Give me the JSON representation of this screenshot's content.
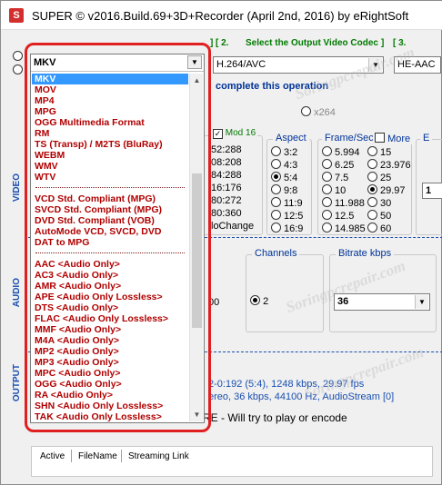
{
  "window": {
    "title": "SUPER © v2016.Build.69+3D+Recorder (April 2nd, 2016) by eRightSoft"
  },
  "steps": {
    "step1_tail": "]",
    "step2_num": "[ 2.",
    "step2_text": "Select the Output Video Codec",
    "step2_close": "]",
    "step3_num": "[ 3."
  },
  "controls": {
    "container_value": "MKV",
    "video_codec_value": "H.264/AVC",
    "audio_codec_value": "HE-AAC",
    "complete_text": "complete this operation",
    "encoder_radio": "x264",
    "mod16_label": "Mod 16",
    "aspect_title": "Aspect",
    "framerate_title": "Frame/Sec",
    "more_label": "More",
    "channels_title": "Channels",
    "channels_value": "2",
    "bitrate_title": "Bitrate  kbps",
    "bitrate_value": "36",
    "sampling_fragment": "00",
    "size_value": "1",
    "e_title": "E"
  },
  "size_options": [
    "52:288",
    "08:208",
    "84:288",
    "16:176",
    "80:272",
    "80:360",
    "loChange"
  ],
  "aspect_options": [
    {
      "label": "3:2",
      "on": false
    },
    {
      "label": "4:3",
      "on": false
    },
    {
      "label": "5:4",
      "on": true
    },
    {
      "label": "9:8",
      "on": false
    },
    {
      "label": "11:9",
      "on": false
    },
    {
      "label": "12:5",
      "on": false
    },
    {
      "label": "16:9",
      "on": false
    }
  ],
  "fps_col1": [
    {
      "label": "5.994",
      "on": false
    },
    {
      "label": "6.25",
      "on": false
    },
    {
      "label": "7.5",
      "on": false
    },
    {
      "label": "10",
      "on": false
    },
    {
      "label": "11.988",
      "on": false
    },
    {
      "label": "12.5",
      "on": false
    },
    {
      "label": "14.985",
      "on": false
    }
  ],
  "fps_col2": [
    {
      "label": "15",
      "on": false
    },
    {
      "label": "23.976",
      "on": false
    },
    {
      "label": "25",
      "on": false
    },
    {
      "label": "29.97",
      "on": true
    },
    {
      "label": "30",
      "on": false
    },
    {
      "label": "50",
      "on": false
    },
    {
      "label": "60",
      "on": false
    }
  ],
  "vertical_labels": {
    "video": "VIDEO",
    "audio": "AUDIO",
    "output": "OUTPUT"
  },
  "info": {
    "video_line": "2-0:192 (5:4),   1248 kbps,  29.97 fps",
    "audio_line": "ereo,  36 kbps,  44100 Hz,  AudioStream [0]",
    "play_line": "RE - Will try to play or encode"
  },
  "dropdown": {
    "selected": "MKV",
    "items": [
      {
        "label": "MKV",
        "sep": false,
        "selected": true
      },
      {
        "label": "MOV",
        "sep": false,
        "selected": false
      },
      {
        "label": "MP4",
        "sep": false,
        "selected": false
      },
      {
        "label": "MPG",
        "sep": false,
        "selected": false
      },
      {
        "label": "OGG  Multimedia Format",
        "sep": false,
        "selected": false
      },
      {
        "label": "RM",
        "sep": false,
        "selected": false
      },
      {
        "label": "TS (Transp) / M2TS (BluRay)",
        "sep": false,
        "selected": false
      },
      {
        "label": "WEBM",
        "sep": false,
        "selected": false
      },
      {
        "label": "WMV",
        "sep": false,
        "selected": false
      },
      {
        "label": "WTV",
        "sep": false,
        "selected": false
      },
      {
        "label": "",
        "sep": true,
        "selected": false
      },
      {
        "label": "VCD  Std. Compliant (MPG)",
        "sep": false,
        "selected": false
      },
      {
        "label": "SVCD Std. Compliant (MPG)",
        "sep": false,
        "selected": false
      },
      {
        "label": "DVD  Std. Compliant (VOB)",
        "sep": false,
        "selected": false
      },
      {
        "label": "AutoMode VCD, SVCD, DVD",
        "sep": false,
        "selected": false
      },
      {
        "label": "DAT  to  MPG",
        "sep": false,
        "selected": false
      },
      {
        "label": "",
        "sep": true,
        "selected": false
      },
      {
        "label": "AAC   <Audio Only>",
        "sep": false,
        "selected": false
      },
      {
        "label": "AC3   <Audio Only>",
        "sep": false,
        "selected": false
      },
      {
        "label": "AMR   <Audio Only>",
        "sep": false,
        "selected": false
      },
      {
        "label": "APE   <Audio Only Lossless>",
        "sep": false,
        "selected": false
      },
      {
        "label": "DTS   <Audio Only>",
        "sep": false,
        "selected": false
      },
      {
        "label": "FLAC  <Audio Only Lossless>",
        "sep": false,
        "selected": false
      },
      {
        "label": "MMF   <Audio Only>",
        "sep": false,
        "selected": false
      },
      {
        "label": "M4A   <Audio Only>",
        "sep": false,
        "selected": false
      },
      {
        "label": "MP2   <Audio Only>",
        "sep": false,
        "selected": false
      },
      {
        "label": "MP3   <Audio Only>",
        "sep": false,
        "selected": false
      },
      {
        "label": "MPC   <Audio Only>",
        "sep": false,
        "selected": false
      },
      {
        "label": "OGG   <Audio Only>",
        "sep": false,
        "selected": false
      },
      {
        "label": "RA    <Audio Only>",
        "sep": false,
        "selected": false
      },
      {
        "label": "SHN   <Audio Only Lossless>",
        "sep": false,
        "selected": false
      },
      {
        "label": "TAK   <Audio Only Lossless>",
        "sep": false,
        "selected": false
      }
    ]
  },
  "bottom_tabs": {
    "active": "Active",
    "filename": "FileName",
    "streaming": "Streaming Link"
  },
  "watermark_text": "Soringpcrepair.com",
  "colors": {
    "highlight_outline": "#e02020",
    "list_text": "#b00000",
    "selection": "#3399ff",
    "step_green": "#007a00",
    "info_blue": "#1a4fb0"
  }
}
